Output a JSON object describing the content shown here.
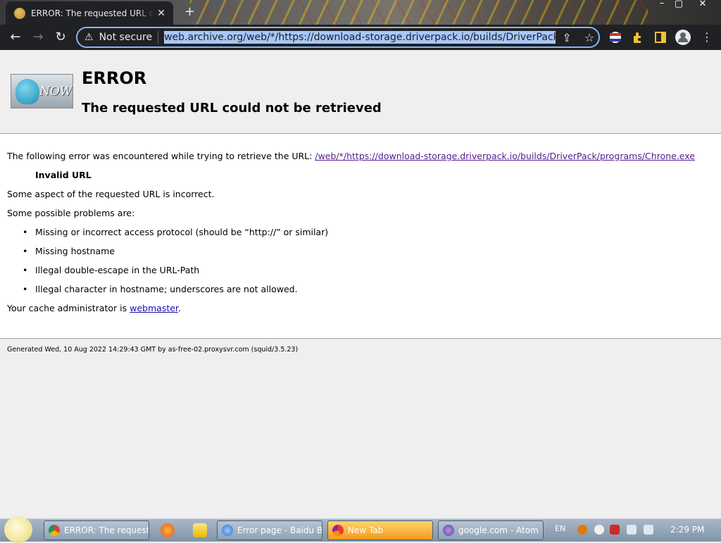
{
  "browser": {
    "tab_title": "ERROR: The requested URL could not be retrieved",
    "tab_close": "✕",
    "new_tab": "+",
    "window_controls": {
      "minimize": "–",
      "maximize": "▢",
      "close": "✕"
    },
    "nav": {
      "back": "←",
      "forward": "→",
      "reload": "↻"
    },
    "security_label": "Not secure",
    "address": "web.archive.org/web/*/https://download-storage.driverpack.io/builds/DriverPack/programs/Chrone.exe",
    "icons": [
      "warning-icon",
      "share-icon",
      "star-icon",
      "profile-flag-icon",
      "extensions-icon",
      "sidepanel-icon",
      "avatar-icon",
      "menu-icon"
    ]
  },
  "page": {
    "logo_text": "NOW",
    "heading": "ERROR",
    "subheading": "The requested URL could not be retrieved",
    "intro": "The following error was encountered while trying to retrieve the URL:",
    "error_url": "/web/*/https://download-storage.driverpack.io/builds/DriverPack/programs/Chrone.exe",
    "error_title": "Invalid URL",
    "aspect": "Some aspect of the requested URL is incorrect.",
    "problems_intro": "Some possible problems are:",
    "problems": [
      "Missing or incorrect access protocol (should be “http://” or similar)",
      "Missing hostname",
      "Illegal double-escape in the URL-Path",
      "Illegal character in hostname; underscores are not allowed."
    ],
    "admin_prefix": "Your cache administrator is",
    "admin_link": "webmaster",
    "admin_suffix": ".",
    "footer": "Generated Wed, 10 Aug 2022 14:29:43 GMT by as-free-02.proxysvr.com (squid/3.5.23)"
  },
  "taskbar": {
    "tasks": [
      {
        "label": "ERROR: The request...",
        "icon": "chrome-icon"
      },
      {
        "label": "Error page - Baidu B...",
        "icon": "browser-icon"
      },
      {
        "label": "New Tab",
        "icon": "browser-icon",
        "active": true
      },
      {
        "label": "google.com - Atom",
        "icon": "atom-icon"
      }
    ],
    "language": "EN",
    "clock": "2:29 PM"
  },
  "colors": {
    "accent": "#8ab4f8",
    "link": "#1a0dab",
    "visited_link": "#551a8b",
    "taskbar_active": "#f39a1f"
  }
}
